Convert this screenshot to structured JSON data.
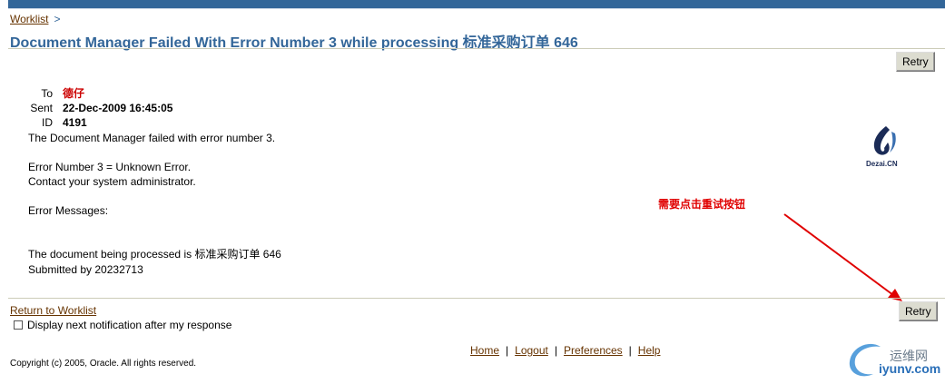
{
  "breadcrumb": {
    "link": "Worklist",
    "separator": ">"
  },
  "page_title": "Document Manager Failed With Error Number 3 while processing 标准采购订单  646",
  "buttons": {
    "retry_top": "Retry",
    "retry_bottom": "Retry"
  },
  "header": {
    "to_label": "To",
    "to_value": "德仔",
    "sent_label": "Sent",
    "sent_value": "22-Dec-2009 16:45:05",
    "id_label": "ID",
    "id_value": "4191"
  },
  "message": {
    "line1": "The Document Manager failed with error number 3.",
    "line2": "Error Number 3 = Unknown Error.",
    "line3": "Contact your system administrator.",
    "line4": "Error Messages:",
    "line5": "The document being processed is 标准采购订单  646",
    "line6": "Submitted by 20232713"
  },
  "logo": {
    "text": "Dezai.CN"
  },
  "annotation": {
    "text": "需要点击重试按钮"
  },
  "footer": {
    "return_link": "Return to Worklist",
    "checkbox_label": "Display next notification after my response",
    "checkbox_checked": false,
    "links": [
      "Home",
      "Logout",
      "Preferences",
      "Help"
    ],
    "copyright": "Copyright (c) 2005, Oracle. All rights reserved."
  },
  "watermark": {
    "cn": "运维网",
    "en": "iyunv.com"
  },
  "colors": {
    "brand_blue": "#336699",
    "link_brown": "#663300",
    "annotation_red": "#e00000"
  }
}
